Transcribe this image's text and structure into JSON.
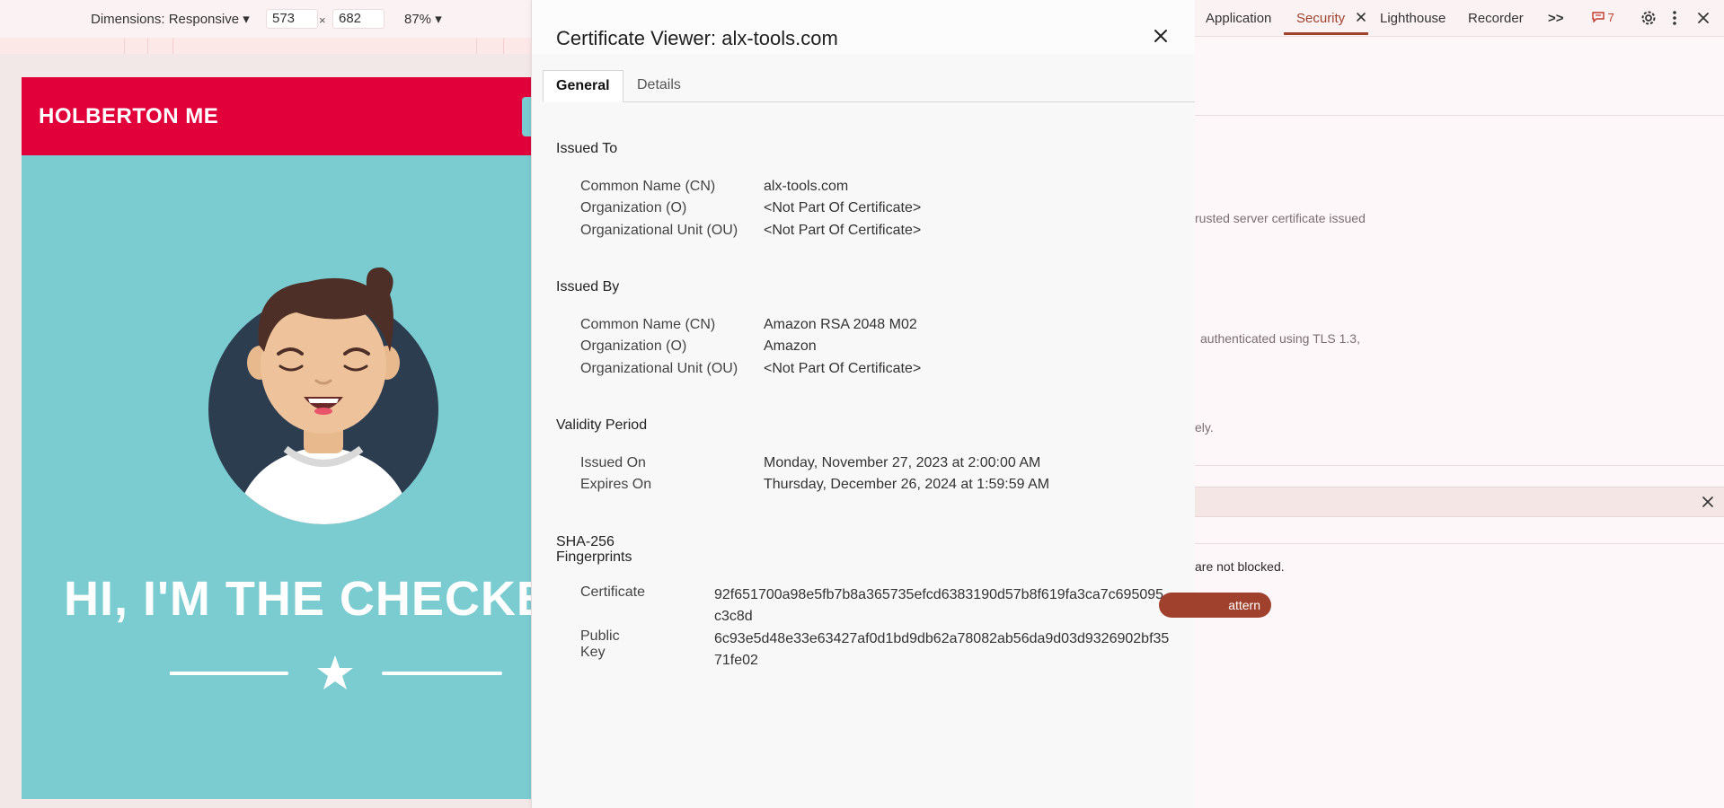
{
  "device_toolbar": {
    "dimensions_label": "Dimensions: Responsive ▾",
    "width_value": "573",
    "times": "×",
    "height_value": "682",
    "zoom_label": "87% ▾"
  },
  "page": {
    "brand": "HOLBERTON ME",
    "hero_text": "HI, I'M THE CHECKE",
    "colors": {
      "header": "#e2003b",
      "background": "#7accd1"
    }
  },
  "cert_viewer": {
    "title": "Certificate Viewer: alx-tools.com",
    "tabs": [
      "General",
      "Details"
    ],
    "issued_to": {
      "heading": "Issued To",
      "rows": [
        {
          "key": "Common Name (CN)",
          "value": "alx-tools.com"
        },
        {
          "key": "Organization (O)",
          "value": "<Not Part Of Certificate>"
        },
        {
          "key": "Organizational Unit (OU)",
          "value": "<Not Part Of Certificate>"
        }
      ]
    },
    "issued_by": {
      "heading": "Issued By",
      "rows": [
        {
          "key": "Common Name (CN)",
          "value": "Amazon RSA 2048 M02"
        },
        {
          "key": "Organization (O)",
          "value": "Amazon"
        },
        {
          "key": "Organizational Unit (OU)",
          "value": "<Not Part Of Certificate>"
        }
      ]
    },
    "validity": {
      "heading": "Validity Period",
      "rows": [
        {
          "key": "Issued On",
          "value": "Monday, November 27, 2023 at 2:00:00 AM"
        },
        {
          "key": "Expires On",
          "value": "Thursday, December 26, 2024 at 1:59:59 AM"
        }
      ]
    },
    "fingerprints": {
      "heading_line1": "SHA-256",
      "heading_line2": "Fingerprints",
      "rows": [
        {
          "key": "Certificate",
          "value": "92f651700a98e5fb7b8a365735efcd6383190d57b8f619fa3ca7c695095c3c8d"
        },
        {
          "key": "Public Key",
          "value": "6c93e5d48e33e63427af0d1bd9db62a78082ab56da9d03d9326902bf3571fe02"
        }
      ]
    }
  },
  "devtools": {
    "tabs": [
      "Application",
      "Security",
      "Lighthouse",
      "Recorder"
    ],
    "active_tab": "Security",
    "more_tabs": ">>",
    "issues_count": "7",
    "snippets": {
      "trusted": "rusted server certificate issued",
      "tls": "authenticated using TLS 1.3,",
      "ely": "ely.",
      "not_blocked": "are not blocked.",
      "pill": "attern"
    },
    "accent_color": "#a0412e"
  }
}
